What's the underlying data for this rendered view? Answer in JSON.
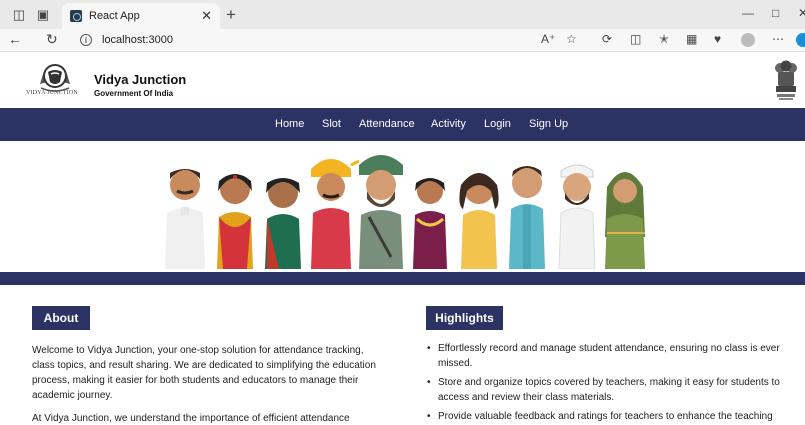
{
  "browser": {
    "tab_title": "React App",
    "url": "localhost:3000"
  },
  "site": {
    "title": "Vidya Junction",
    "subtitle": "Government Of India",
    "logo_caption": "VIDYA JUNCTION"
  },
  "nav": {
    "items": [
      "Home",
      "Slot",
      "Attendance",
      "Activity",
      "Login",
      "Sign Up"
    ]
  },
  "about": {
    "heading": "About",
    "para1": "Welcome to Vidya Junction, your one-stop solution for attendance tracking, class topics, and result sharing. We are dedicated to simplifying the education process, making it easier for both students and educators to manage their academic journey.",
    "para2": "At Vidya Junction, we understand the importance of efficient attendance"
  },
  "highlights": {
    "heading": "Highlights",
    "items": [
      "Effortlessly record and manage student attendance, ensuring no class is ever missed.",
      "Store and organize topics covered by teachers, making it easy for students to access and review their class materials.",
      "Provide valuable feedback and ratings for teachers to enhance the teaching experience and promote quality education."
    ]
  },
  "colors": {
    "brand_navy": "#2b3365",
    "chrome": "#e9e9e9"
  }
}
